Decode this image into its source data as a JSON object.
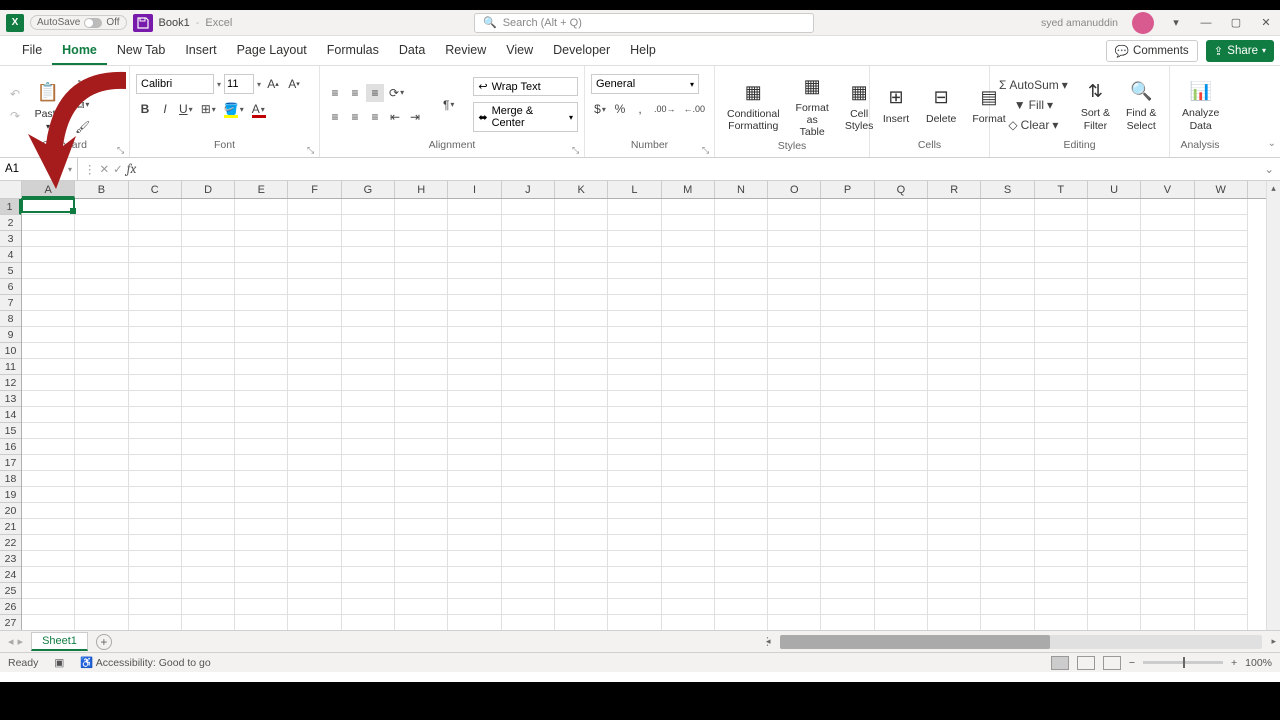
{
  "titlebar": {
    "autosave": "AutoSave",
    "autosave_state": "Off",
    "book": "Book1",
    "app": "Excel",
    "search_placeholder": "Search (Alt + Q)",
    "user": "syed amanuddin"
  },
  "menus": {
    "items": [
      "File",
      "Home",
      "New Tab",
      "Insert",
      "Page Layout",
      "Formulas",
      "Data",
      "Review",
      "View",
      "Developer",
      "Help"
    ],
    "active": "Home",
    "comments": "Comments",
    "share": "Share"
  },
  "ribbon": {
    "clipboard": {
      "paste": "Paste",
      "label": "Clipboard"
    },
    "font": {
      "name": "Calibri",
      "size": "11",
      "label": "Font"
    },
    "alignment": {
      "wrap": "Wrap Text",
      "merge": "Merge & Center",
      "label": "Alignment"
    },
    "number": {
      "format": "General",
      "label": "Number"
    },
    "styles": {
      "cond": "Conditional\nFormatting",
      "fmt_table": "Format as\nTable",
      "cell_styles": "Cell\nStyles",
      "label": "Styles"
    },
    "cells": {
      "insert": "Insert",
      "delete": "Delete",
      "format": "Format",
      "label": "Cells"
    },
    "editing": {
      "autosum": "AutoSum",
      "fill": "Fill",
      "clear": "Clear",
      "sort": "Sort &\nFilter",
      "find": "Find &\nSelect",
      "label": "Editing"
    },
    "analysis": {
      "analyze": "Analyze\nData",
      "label": "Analysis"
    }
  },
  "formulabar": {
    "namebox": "A1",
    "formula": ""
  },
  "grid": {
    "cols": [
      "A",
      "B",
      "C",
      "D",
      "E",
      "F",
      "G",
      "H",
      "I",
      "J",
      "K",
      "L",
      "M",
      "N",
      "O",
      "P",
      "Q",
      "R",
      "S",
      "T",
      "U",
      "V",
      "W"
    ],
    "rows": 28,
    "active_ref": "A1"
  },
  "sheettabs": {
    "tabs": [
      "Sheet1"
    ],
    "active": "Sheet1"
  },
  "status": {
    "ready": "Ready",
    "accessibility": "Accessibility: Good to go",
    "zoom": "100%"
  }
}
